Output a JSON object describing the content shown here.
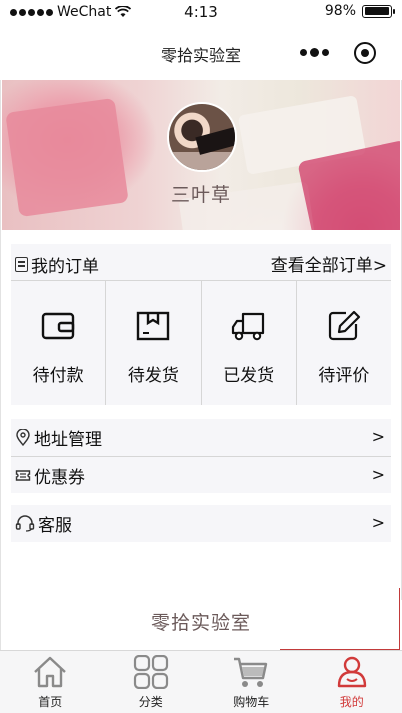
{
  "status_bar": {
    "carrier": "WeChat",
    "time": "4:13",
    "battery": "98%"
  },
  "nav": {
    "title": "零拾实验室"
  },
  "profile": {
    "name": "三叶草"
  },
  "orders": {
    "title": "我的订单",
    "view_all": "查看全部订单>",
    "items": [
      {
        "label": "待付款",
        "icon": "wallet-icon"
      },
      {
        "label": "待发货",
        "icon": "package-icon"
      },
      {
        "label": "已发货",
        "icon": "truck-icon"
      },
      {
        "label": "待评价",
        "icon": "edit-icon"
      }
    ]
  },
  "menu": {
    "address": "地址管理",
    "coupon": "优惠券",
    "service": "客服",
    "chevron": ">"
  },
  "footer": {
    "brand": "零拾实验室"
  },
  "tab_bar": {
    "items": [
      {
        "label": "首页",
        "icon": "home-icon"
      },
      {
        "label": "分类",
        "icon": "grid-icon"
      },
      {
        "label": "购物车",
        "icon": "cart-icon"
      },
      {
        "label": "我的",
        "icon": "user-icon",
        "active": true
      }
    ]
  },
  "colors": {
    "accent": "#d13a3a",
    "panel_bg": "#f6f6f9"
  }
}
